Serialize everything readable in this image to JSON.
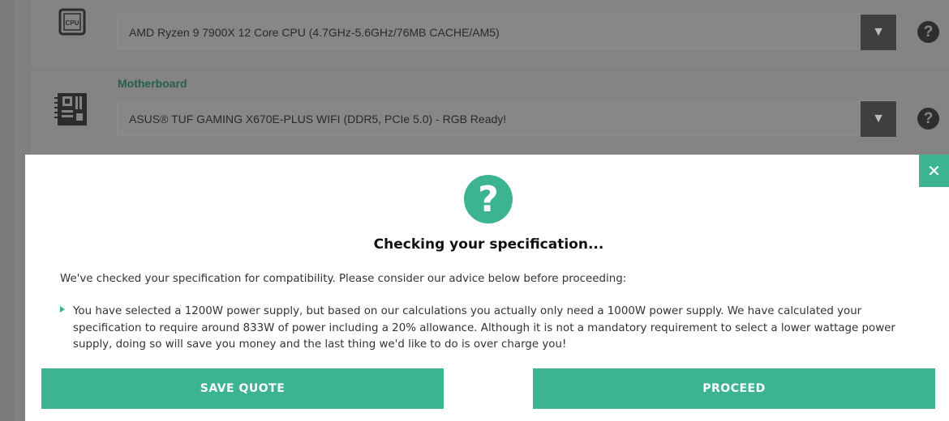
{
  "background": {
    "cpu_row": {
      "icon": "cpu-icon",
      "icon_text": "CPU",
      "selected": "AMD Ryzen 9 7900X 12 Core CPU (4.7GHz-5.6GHz/76MB CACHE/AM5)"
    },
    "motherboard_row": {
      "label": "Motherboard",
      "icon": "motherboard-icon",
      "selected": "ASUS® TUF GAMING X670E-PLUS WIFI (DDR5, PCIe 5.0) - RGB Ready!"
    },
    "dropdown_arrow": "▼",
    "help_symbol": "?"
  },
  "modal": {
    "icon": "question-circle-icon",
    "icon_symbol": "?",
    "close_symbol": "✕",
    "title": "Checking your specification...",
    "intro": "We've checked your specification for compatibility. Please consider our advice below before proceeding:",
    "advice": [
      "You have selected a 1200W power supply, but based on our calculations you actually only need a 1000W power supply. We have calculated your specification to require around 833W of power including a 20% allowance. Although it is not a mandatory requirement to select a lower wattage power supply, doing so will save you money and the last thing we'd like to do is over charge you!"
    ],
    "buttons": {
      "save_quote": "SAVE QUOTE",
      "proceed": "PROCEED"
    }
  },
  "colors": {
    "accent": "#3cb491",
    "overlay_bg": "#808080",
    "modal_bg": "#ffffff"
  }
}
